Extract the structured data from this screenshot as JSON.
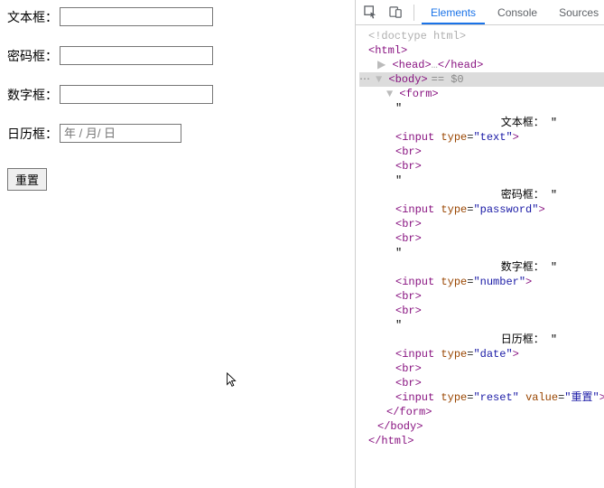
{
  "form": {
    "fields": [
      {
        "label": "文本框：",
        "type": "text",
        "value": ""
      },
      {
        "label": "密码框：",
        "type": "password",
        "value": ""
      },
      {
        "label": "数字框：",
        "type": "number",
        "value": ""
      },
      {
        "label": "日历框：",
        "type": "date",
        "placeholder": "年 / 月/ 日",
        "value": ""
      }
    ],
    "reset_label": "重置"
  },
  "devtools": {
    "tabs": {
      "elements": "Elements",
      "console": "Console",
      "sources": "Sources"
    },
    "selected_node_hint": "== $0",
    "dom": {
      "doctype": "<!doctype html>",
      "html_open": "html",
      "head_collapsed": "head",
      "body_open": "body",
      "form_open": "form",
      "lines": [
        {
          "text_label": "文本框：",
          "tag": "input",
          "attrs": [
            [
              "type",
              "text"
            ]
          ]
        },
        {
          "br": 2
        },
        {
          "text_label": "密码框：",
          "tag": "input",
          "attrs": [
            [
              "type",
              "password"
            ]
          ]
        },
        {
          "br": 2
        },
        {
          "text_label": "数字框：",
          "tag": "input",
          "attrs": [
            [
              "type",
              "number"
            ]
          ]
        },
        {
          "br": 2
        },
        {
          "text_label": "日历框：",
          "tag": "input",
          "attrs": [
            [
              "type",
              "date"
            ]
          ]
        },
        {
          "br": 2
        },
        {
          "tag": "input",
          "attrs": [
            [
              "type",
              "reset"
            ],
            [
              "value",
              "重置"
            ]
          ]
        }
      ],
      "form_close": "form",
      "body_close": "body",
      "html_close": "html"
    }
  }
}
